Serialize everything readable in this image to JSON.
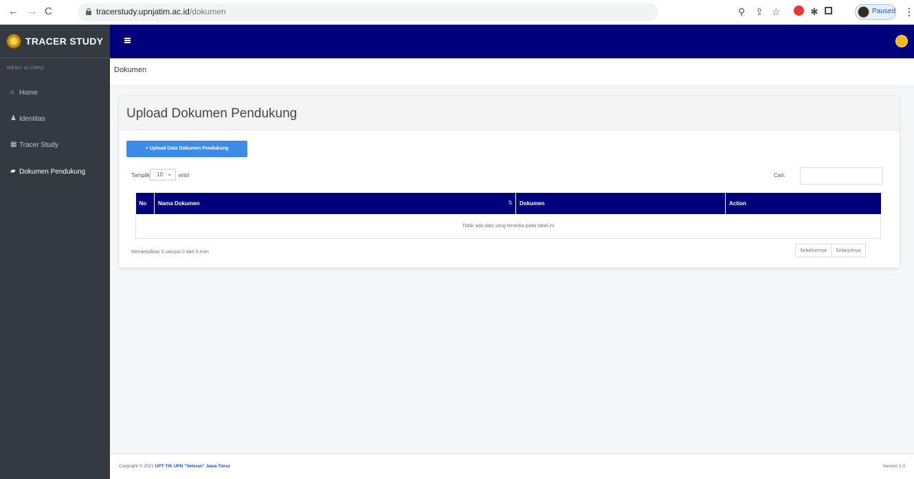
{
  "browser": {
    "url_host": "tracerstudy.upnjatim.ac.id",
    "url_path": "/dokumen",
    "profile_label": "Paused"
  },
  "sidebar": {
    "brand": "TRACER STUDY",
    "menu_header": "MENU ALUMNI",
    "items": [
      {
        "label": "Home",
        "icon": "home-icon"
      },
      {
        "label": "Identitas",
        "icon": "user-icon"
      },
      {
        "label": "Tracer Study",
        "icon": "table-icon"
      },
      {
        "label": "Dokumen Pendukung",
        "icon": "book-icon",
        "active": true
      }
    ]
  },
  "content": {
    "breadcrumb": "Dokumen",
    "card_title": "Upload Dokumen Pendukung",
    "upload_button": "Upload Data Dokumen Pendukung",
    "length_label": "Tampilkan",
    "length_value": "10",
    "length_suffix": "entri",
    "search_label": "Cari:",
    "table": {
      "columns": [
        "No",
        "Nama Dokumen",
        "Dokumen",
        "Action"
      ],
      "empty_message": "Tidak ada data yang tersedia pada tabel ini"
    },
    "info": "Menampilkan 0 sampai 0 dari 0 entri",
    "pager": {
      "previous": "Sebelumnya",
      "next": "Selanjutnya"
    }
  },
  "footer": {
    "copyright_prefix": "Copyright © 2021",
    "copyright_link": "UPT TIK UPN \"Veteran\" Jawa Timur",
    "version": "Version 1.0"
  },
  "colors": {
    "navbar": "#00007c",
    "sidebar": "#343a40",
    "button": "#3c8ce7"
  }
}
